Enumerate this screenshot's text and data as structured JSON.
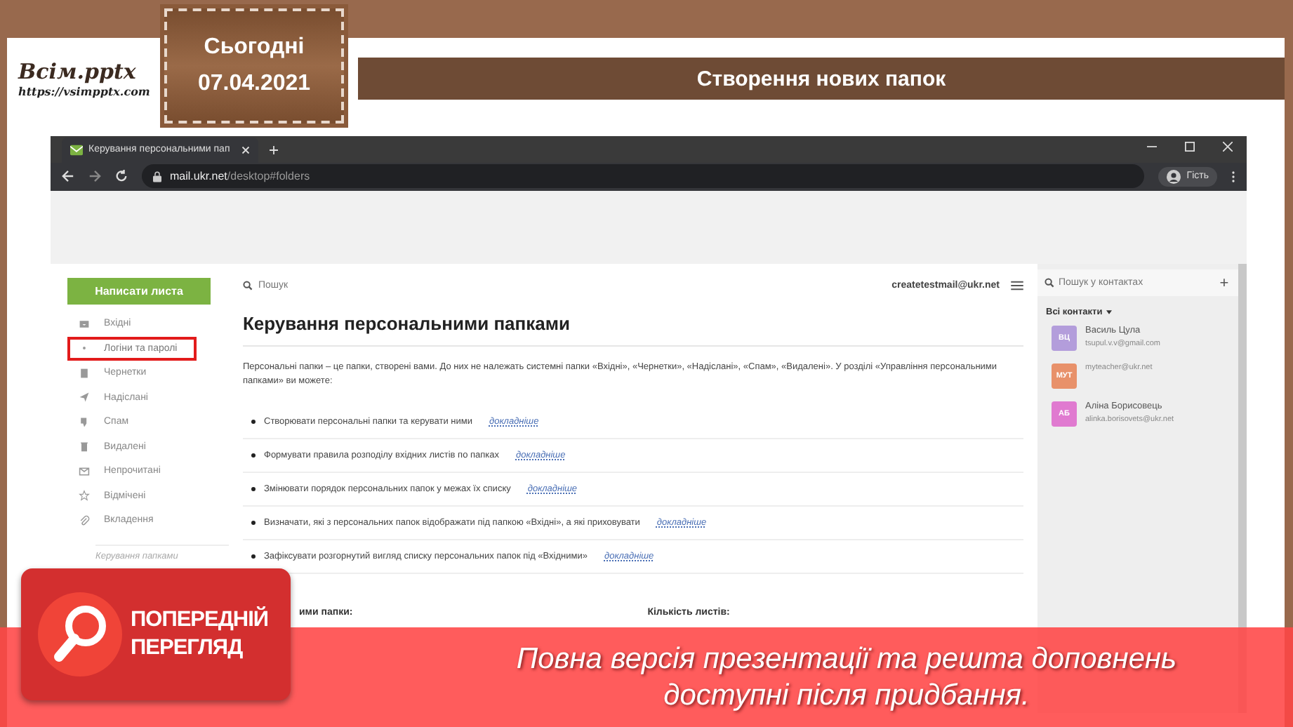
{
  "logo": {
    "title": "Всім.pptx",
    "url": "https://vsimpptx.com"
  },
  "date_tag": {
    "label": "Сьогодні",
    "date": "07.04.2021"
  },
  "slide_title": "Створення нових папок",
  "browser": {
    "tab_title": "Керування персональними пап",
    "url_host": "mail.ukr.net",
    "url_path": "/desktop#folders",
    "profile": "Гість"
  },
  "mail": {
    "compose": "Написати листа",
    "folders": [
      {
        "kind": "inbox",
        "label": "Вхідні",
        "highlighted": false
      },
      {
        "kind": "dot",
        "label": "Логіни та паролі",
        "highlighted": true
      },
      {
        "kind": "draft",
        "label": "Чернетки",
        "highlighted": false
      },
      {
        "kind": "sent",
        "label": "Надіслані",
        "highlighted": false
      },
      {
        "kind": "spam",
        "label": "Спам",
        "highlighted": false
      },
      {
        "kind": "trash",
        "label": "Видалені",
        "highlighted": false
      },
      {
        "kind": "unread",
        "label": "Непрочитані",
        "highlighted": false
      },
      {
        "kind": "star",
        "label": "Відмічені",
        "highlighted": false
      },
      {
        "kind": "attach",
        "label": "Вкладення",
        "highlighted": false
      }
    ],
    "folders_footer": "Керування папками",
    "search_placeholder": "Пошук",
    "account": "createtestmail@ukr.net",
    "heading": "Керування персональними папками",
    "intro": "Персональні папки – це папки, створені вами. До них не належать системні папки «Вхідні», «Чернетки», «Надіслані», «Спам», «Видалені». У розділі «Управління персональними папками» ви можете:",
    "features": [
      {
        "text": "Створювати персональні папки та керувати ними",
        "link": "докладніше"
      },
      {
        "text": "Формувати правила розподілу вхідних листів по папках",
        "link": "докладніше"
      },
      {
        "text": "Змінювати порядок персональних папок у межах їх списку",
        "link": "докладніше"
      },
      {
        "text": "Визначати, які з персональних папок відображати під папкою «Вхідні», а які приховувати",
        "link": "докладніше"
      },
      {
        "text": "Зафіксувати розгорнутий вигляд списку персональних папок під «Вхідними»",
        "link": "докладніше"
      }
    ],
    "table_headers": [
      "ими папки:",
      "Кількість листів:"
    ]
  },
  "contacts": {
    "search_placeholder": "Пошук у контактах",
    "add": "+",
    "filter": "Всі контакти",
    "items": [
      {
        "initials": "ВЦ",
        "name": "Василь Цула",
        "email": "tsupul.v.v@gmail.com",
        "color": "#b39ddb"
      },
      {
        "initials": "МУТ",
        "email": "myteacher@ukr.net",
        "color": "#e8916a"
      },
      {
        "initials": "АБ",
        "name": "Аліна Борисовець",
        "email": "alinka.borisovets@ukr.net",
        "color": "#e07ad0"
      }
    ]
  },
  "preview_banner": {
    "badge": [
      "ПОПЕРЕДНІЙ",
      "ПЕРЕГЛЯД"
    ],
    "message": [
      "Повна версія презентації та решта доповнень",
      "доступні після придбання."
    ]
  }
}
